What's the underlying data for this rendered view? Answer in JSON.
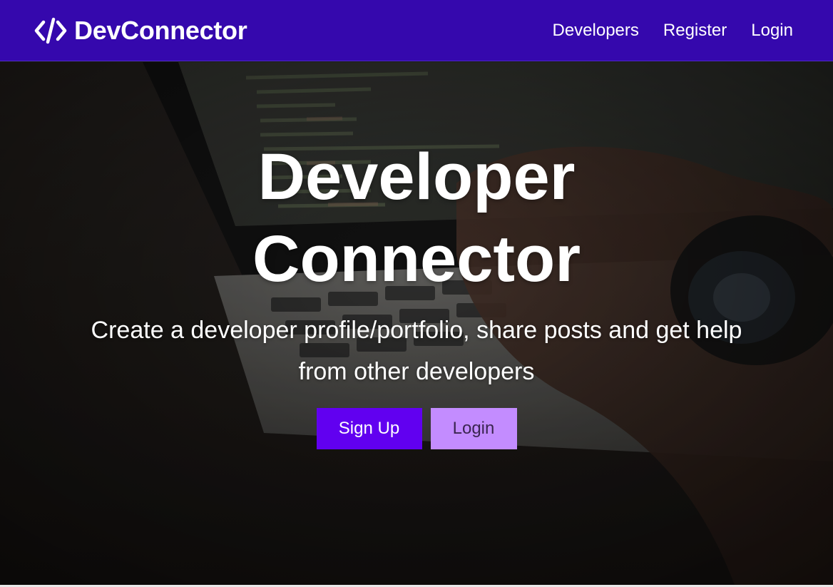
{
  "navbar": {
    "brand_icon": "code-brackets-icon",
    "brand_text": "DevConnector",
    "links": [
      {
        "label": "Developers"
      },
      {
        "label": "Register"
      },
      {
        "label": "Login"
      }
    ]
  },
  "hero": {
    "background": "dim photo of hands typing on a laptop showing CSS code",
    "title": "Developer Connector",
    "subtitle": "Create a developer profile/portfolio, share posts and get help from other developers",
    "buttons": {
      "primary_label": "Sign Up",
      "secondary_label": "Login"
    }
  },
  "colors": {
    "navbar": "#3508ad",
    "primary_button": "#6100f0",
    "secondary_button": "#c38cff",
    "text": "#ffffff"
  }
}
